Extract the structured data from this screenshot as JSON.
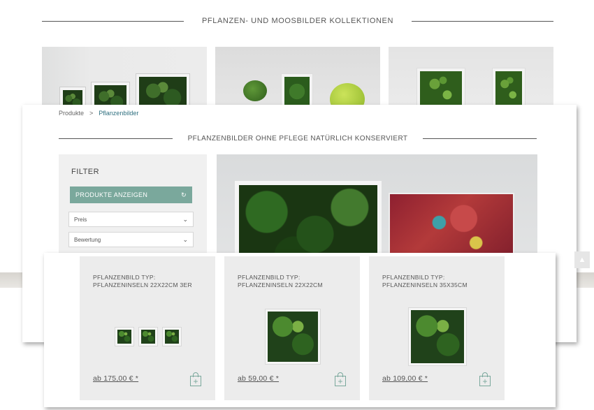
{
  "collection": {
    "title": "PFLANZEN- UND MOOSBILDER KOLLEKTIONEN"
  },
  "breadcrumb": {
    "items": [
      "Produkte",
      "Pflanzenbilder"
    ],
    "separator": ">"
  },
  "category": {
    "title": "PFLANZENBILDER OHNE PFLEGE NATÜRLICH KONSERVIERT"
  },
  "filter": {
    "title": "FILTER",
    "apply_label": "PRODUKTE ANZEIGEN",
    "refresh_icon": "↻",
    "selects": [
      "Preis",
      "Bewertung"
    ],
    "chevron": "⌄"
  },
  "products": [
    {
      "title": "PFLANZENBILD TYP: PFLANZENINSELN 22X22CM 3ER",
      "price": "ab 175,00 € *"
    },
    {
      "title": "PFLANZENBILD TYP: PFLANZENINSELN 22X22CM",
      "price": "ab 59,00 € *"
    },
    {
      "title": "PFLANZENBILD TYP: PFLANZENINSELN 35X35CM",
      "price": "ab 109,00 € *"
    }
  ],
  "cart_icon_symbol": "+",
  "scroll_top_symbol": "▲",
  "colors": {
    "accent": "#7aa89c",
    "link": "#2e6f7f",
    "card_bg": "#ececec",
    "text": "#555555"
  }
}
